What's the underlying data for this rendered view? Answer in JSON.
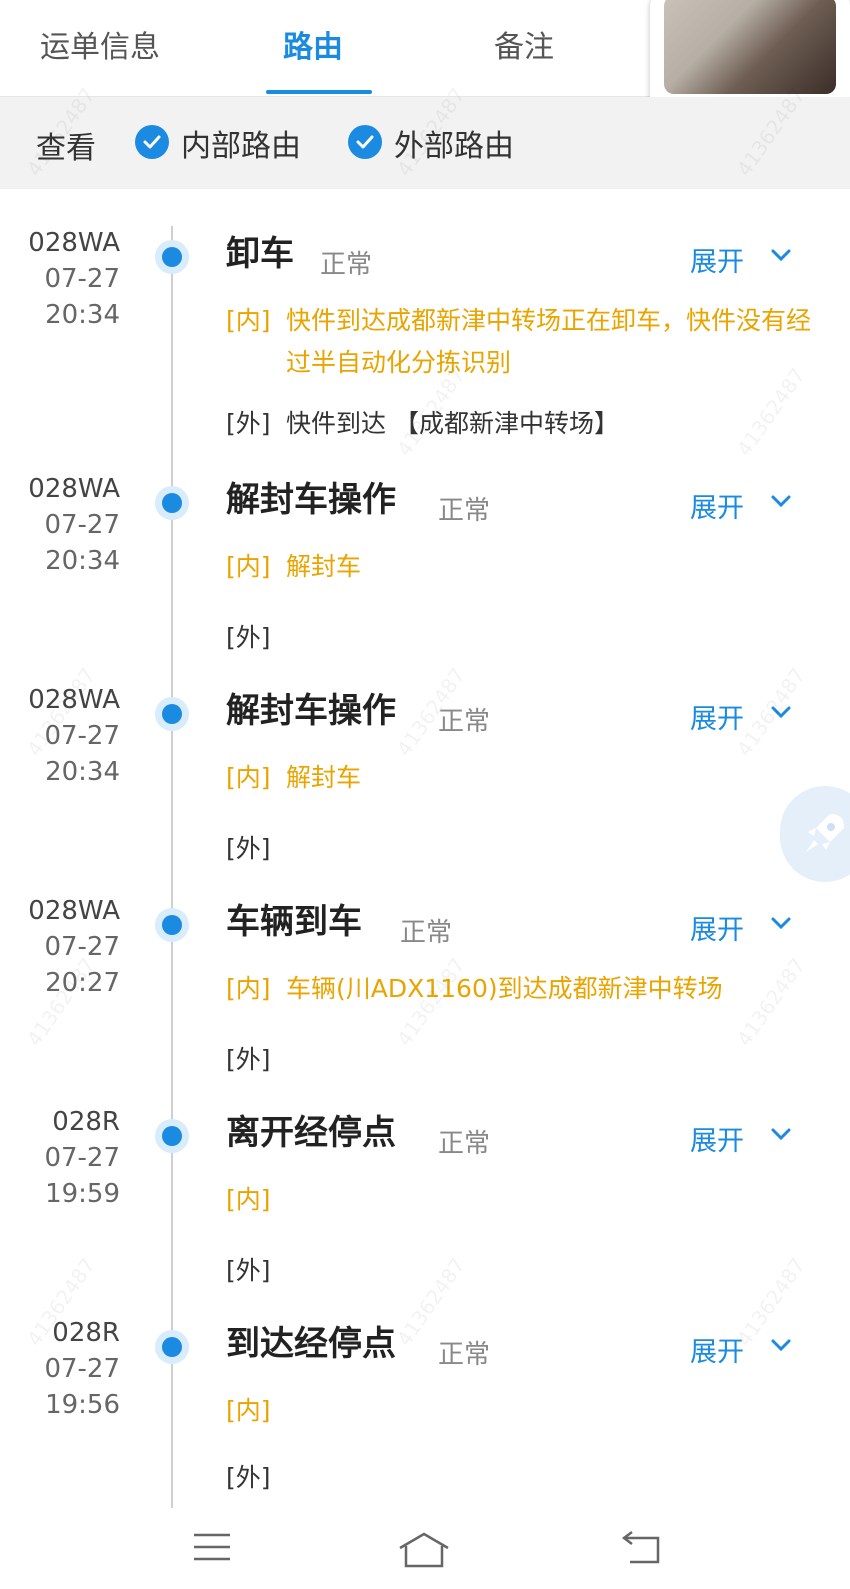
{
  "tabs": [
    {
      "label": "运单信息",
      "active": false
    },
    {
      "label": "路由",
      "active": true
    },
    {
      "label": "备注",
      "active": false
    }
  ],
  "filter": {
    "label": "查看",
    "options": [
      {
        "label": "内部路由",
        "checked": true
      },
      {
        "label": "外部路由",
        "checked": true
      }
    ]
  },
  "watermark": "41362487",
  "colors": {
    "accent": "#1a8be0",
    "inner_text": "#e9a400"
  },
  "events": [
    {
      "code": "028WA",
      "date": "07-27",
      "time": "20:34",
      "title": "卸车",
      "status": "正常",
      "expand": "展开",
      "inner_tag": "[内]",
      "inner": "快件到达成都新津中转场正在卸车，快件没有经过半自动化分拣识别",
      "outer_tag": "[外]",
      "outer": "快件到达 【成都新津中转场】"
    },
    {
      "code": "028WA",
      "date": "07-27",
      "time": "20:34",
      "title": "解封车操作",
      "status": "正常",
      "expand": "展开",
      "inner_tag": "[内]",
      "inner": "解封车",
      "outer_tag": "[外]",
      "outer": ""
    },
    {
      "code": "028WA",
      "date": "07-27",
      "time": "20:34",
      "title": "解封车操作",
      "status": "正常",
      "expand": "展开",
      "inner_tag": "[内]",
      "inner": "解封车",
      "outer_tag": "[外]",
      "outer": ""
    },
    {
      "code": "028WA",
      "date": "07-27",
      "time": "20:27",
      "title": "车辆到车",
      "status": "正常",
      "expand": "展开",
      "inner_tag": "[内]",
      "inner": "车辆(川ADX1160)到达成都新津中转场",
      "outer_tag": "[外]",
      "outer": ""
    },
    {
      "code": "028R",
      "date": "07-27",
      "time": "19:59",
      "title": "离开经停点",
      "status": "正常",
      "expand": "展开",
      "inner_tag": "[内]",
      "inner": "",
      "outer_tag": "[外]",
      "outer": ""
    },
    {
      "code": "028R",
      "date": "07-27",
      "time": "19:56",
      "title": "到达经停点",
      "status": "正常",
      "expand": "展开",
      "inner_tag": "[内]",
      "inner": "",
      "outer_tag": "[外]",
      "outer": ""
    }
  ],
  "navbar": {
    "icons": [
      "menu-icon",
      "home-icon",
      "back-icon"
    ]
  }
}
